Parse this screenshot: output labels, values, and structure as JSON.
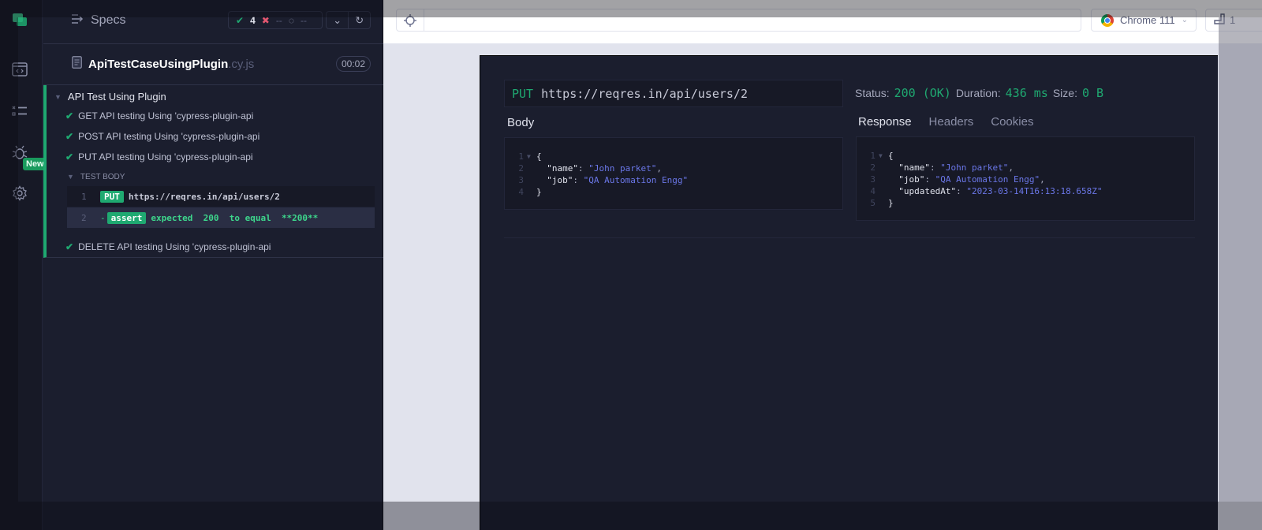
{
  "nav": {
    "new_badge": "New",
    "icons": [
      "cypress-logo-icon",
      "specs-list-icon",
      "runs-icon",
      "debug-icon",
      "settings-icon"
    ]
  },
  "reporter": {
    "specs_label": "Specs",
    "stats": {
      "passed": "4",
      "failed": "--",
      "pending": "--"
    },
    "spec_file": {
      "name": "ApiTestCaseUsingPlugin",
      "ext": ".cy.js",
      "duration": "00:02"
    },
    "suite": {
      "title": "API Test Using Plugin",
      "tests": [
        {
          "title": "GET API testing Using 'cypress-plugin-api",
          "state": "passed"
        },
        {
          "title": "POST API testing Using 'cypress-plugin-api",
          "state": "passed"
        },
        {
          "title": "PUT API testing Using 'cypress-plugin-api",
          "state": "passed"
        },
        {
          "title": "DELETE API testing Using 'cypress-plugin-api",
          "state": "passed"
        }
      ],
      "test_body_label": "TEST BODY",
      "commands": [
        {
          "num": "1",
          "tag": "PUT",
          "text": "https://reqres.in/api/users/2"
        },
        {
          "num": "2",
          "prefix": "-",
          "tag": "assert",
          "text": "expected  200  to equal  **200**"
        }
      ]
    }
  },
  "topbar": {
    "url": "",
    "browser": "Chrome 111",
    "viewport": "1"
  },
  "api_view": {
    "method": "PUT",
    "url": "https://reqres.in/api/users/2",
    "status_label": "Status:",
    "status_value": "200 (OK)",
    "duration_label": "Duration:",
    "duration_value": "436 ms",
    "size_label": "Size:",
    "size_value": "0 B",
    "body_label": "Body",
    "tabs": [
      "Response",
      "Headers",
      "Cookies"
    ],
    "active_tab": "Response",
    "request_body": [
      {
        "ln": "1",
        "fold": true,
        "text": "{"
      },
      {
        "ln": "2",
        "key": "\"name\"",
        "value": "\"John parket\"",
        "trail": ","
      },
      {
        "ln": "3",
        "key": "\"job\"",
        "value": "\"QA Automation Engg\"",
        "trail": ""
      },
      {
        "ln": "4",
        "text": "}"
      }
    ],
    "response_body": [
      {
        "ln": "1",
        "fold": true,
        "text": "{"
      },
      {
        "ln": "2",
        "key": "\"name\"",
        "value": "\"John parket\"",
        "trail": ","
      },
      {
        "ln": "3",
        "key": "\"job\"",
        "value": "\"QA Automation Engg\"",
        "trail": ","
      },
      {
        "ln": "4",
        "key": "\"updatedAt\"",
        "value": "\"2023-03-14T16:13:18.658Z\"",
        "trail": ""
      },
      {
        "ln": "5",
        "text": "}"
      }
    ]
  },
  "colors": {
    "pass": "#1fa971",
    "fail": "#e45770",
    "string": "#6b77e8",
    "background": "#1b1e2e"
  }
}
